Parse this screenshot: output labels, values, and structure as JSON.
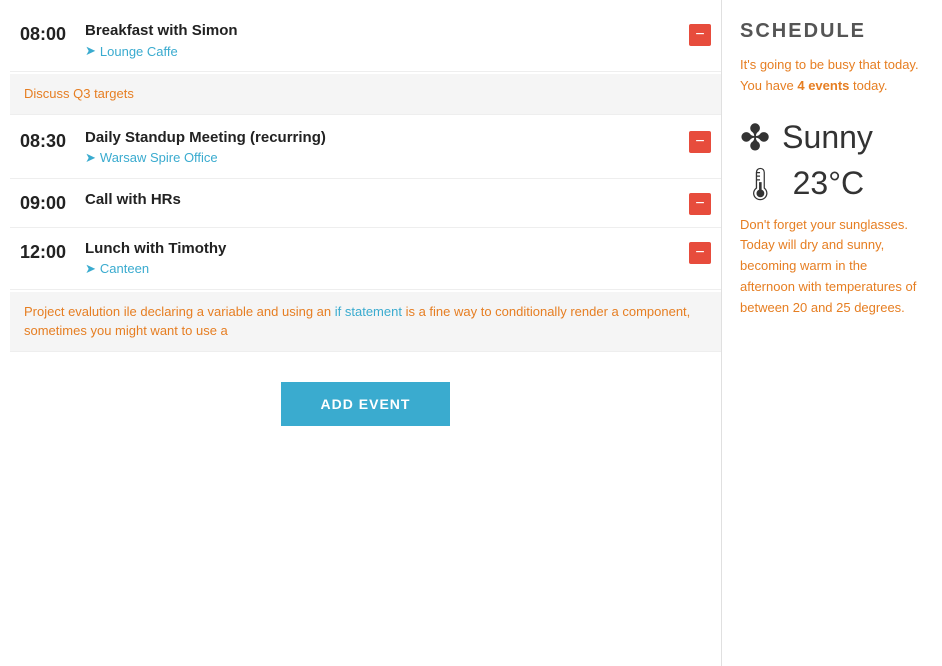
{
  "events": [
    {
      "time": "08:00",
      "title": "Breakfast with Simon",
      "location": "Lounge Caffe",
      "note": "Discuss Q3 targets"
    },
    {
      "time": "08:30",
      "title": "Daily Standup Meeting (recurring)",
      "location": "Warsaw Spire Office",
      "note": null
    },
    {
      "time": "09:00",
      "title": "Call with HRs",
      "location": null,
      "note": null
    },
    {
      "time": "12:00",
      "title": "Lunch with Timothy",
      "location": "Canteen",
      "note": "Project evalution ile declaring a variable and using an if statement is a fine way to conditionally render a component, sometimes you might want to use a"
    }
  ],
  "add_event_label": "ADD EVENT",
  "sidebar": {
    "schedule_title": "SCHEDULE",
    "intro_text_1": "It's going to be busy that today. You have ",
    "event_count": "4 events",
    "intro_text_2": " today.",
    "weather_condition": "Sunny",
    "weather_temp": "23°C",
    "weather_detail": "Don't forget your sunglasses. Today will dry and sunny, becoming warm in the afternoon with temperatures of between 20 and 25 degrees."
  },
  "icons": {
    "sun": "✦",
    "thermometer": "🌡",
    "location": "➤",
    "delete": "−"
  }
}
